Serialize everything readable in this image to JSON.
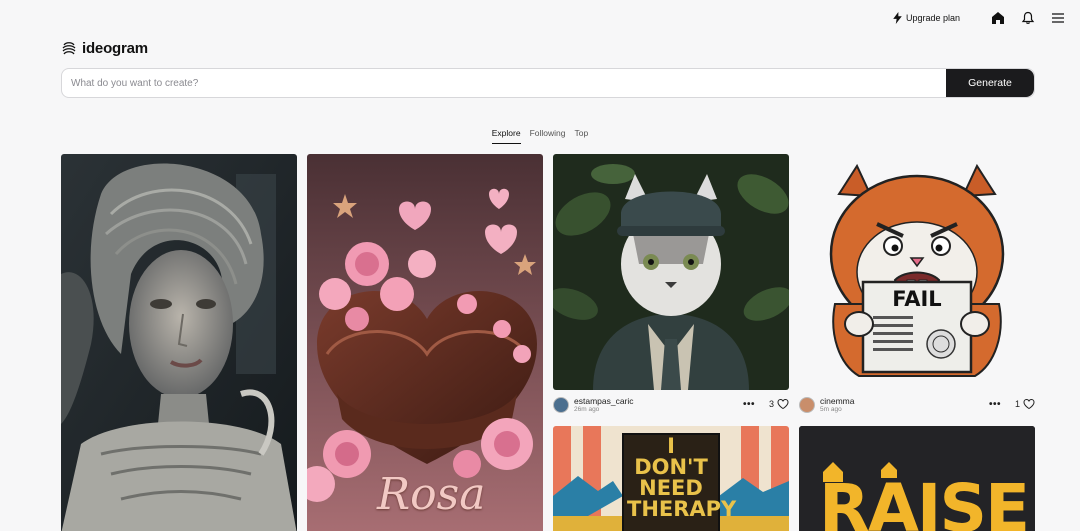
{
  "header": {
    "upgrade_label": "Upgrade plan",
    "logo_text": "ideogram"
  },
  "search": {
    "placeholder": "What do you want to create?",
    "value": "",
    "generate_label": "Generate"
  },
  "tabs": [
    {
      "label": "Explore",
      "active": true
    },
    {
      "label": "Following",
      "active": false
    },
    {
      "label": "Top",
      "active": false
    }
  ],
  "cards": {
    "c1": {
      "description": "Biomechanical alien woman portrait"
    },
    "c2": {
      "text": "Rosa"
    },
    "c3": {
      "user": "estampas_caric",
      "time": "26m ago",
      "likes": "3"
    },
    "c4": {
      "user": "cinemma",
      "time": "5m ago",
      "likes": "1",
      "sign_text": "FAIL"
    },
    "c5": {
      "text": "I DON'T NEED THERAPY"
    },
    "c6": {
      "text": "RAISE"
    }
  }
}
